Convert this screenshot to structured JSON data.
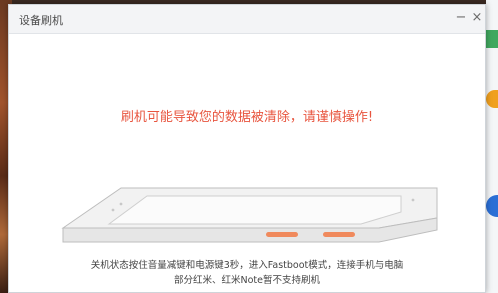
{
  "dialog": {
    "title": "设备刷机",
    "minimize_glyph": "−",
    "close_glyph": "×",
    "warning": "刷机可能导致您的数据被清除，请谨慎操作!",
    "instruction_line1": "关机状态按住音量减键和电源键3秒，进入Fastboot模式，连接手机与电脑",
    "instruction_line2": "部分红米、红米Note暂不支持刷机"
  },
  "colors": {
    "warning": "#e8553f",
    "highlight_button": "#f08a5d"
  },
  "icons": [
    "minimize-icon",
    "close-icon",
    "phone-illustration"
  ]
}
